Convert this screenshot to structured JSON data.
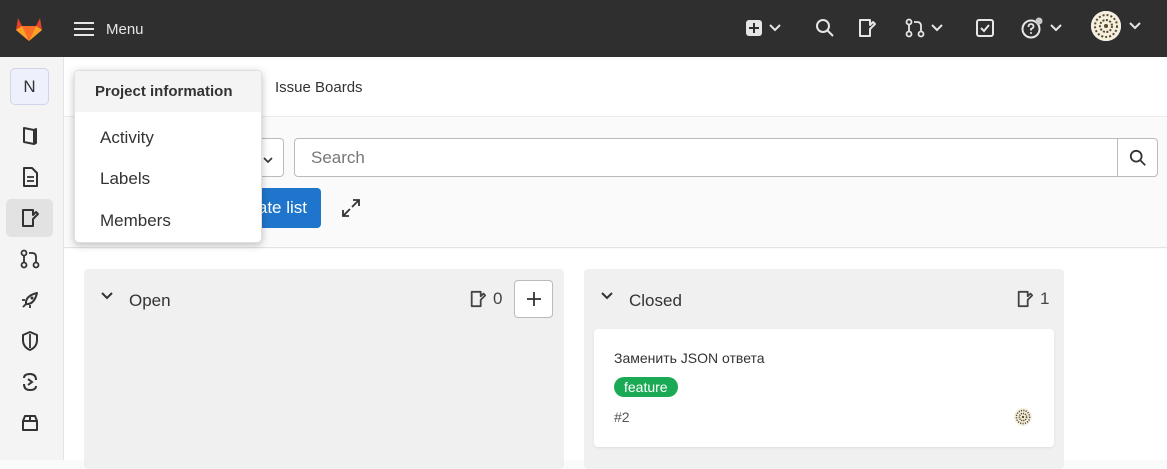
{
  "topbar": {
    "menu_label": "Menu",
    "icons": [
      "gitlab-logo",
      "new-item-icon",
      "search-icon",
      "issues-icon",
      "merge-requests-icon",
      "todos-icon",
      "help-icon",
      "user-avatar"
    ]
  },
  "sidebar": {
    "project_initial": "N",
    "items": [
      {
        "name": "project-overview",
        "active": false
      },
      {
        "name": "repository",
        "active": false
      },
      {
        "name": "issues",
        "active": true
      },
      {
        "name": "merge-requests",
        "active": false
      },
      {
        "name": "ci-cd",
        "active": false
      },
      {
        "name": "security",
        "active": false
      },
      {
        "name": "deployments",
        "active": false
      },
      {
        "name": "packages",
        "active": false
      }
    ]
  },
  "breadcrumb": {
    "current": "Issue Boards"
  },
  "filter": {
    "search_placeholder": "Search",
    "create_list_label": "Create list"
  },
  "dropdown": {
    "header": "Project information",
    "items": [
      "Activity",
      "Labels",
      "Members"
    ]
  },
  "board": {
    "lists": [
      {
        "title": "Open",
        "count": "0",
        "cards": []
      },
      {
        "title": "Closed",
        "count": "1",
        "cards": [
          {
            "title": "Заменить JSON ответа",
            "label": "feature",
            "ref": "#2"
          }
        ]
      }
    ]
  },
  "colors": {
    "topbar": "#2f2f2f",
    "primary": "#1f75cb",
    "label_feature": "#1aaa55"
  }
}
